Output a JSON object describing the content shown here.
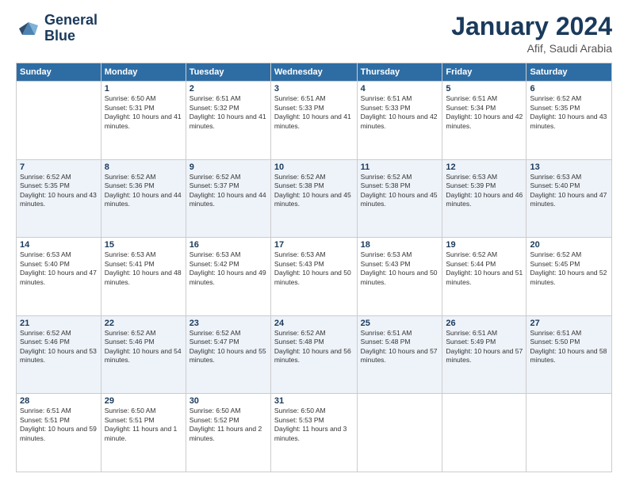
{
  "header": {
    "logo_line1": "General",
    "logo_line2": "Blue",
    "month": "January 2024",
    "location": "Afif, Saudi Arabia"
  },
  "weekdays": [
    "Sunday",
    "Monday",
    "Tuesday",
    "Wednesday",
    "Thursday",
    "Friday",
    "Saturday"
  ],
  "weeks": [
    [
      {
        "day": "",
        "sunrise": "",
        "sunset": "",
        "daylight": ""
      },
      {
        "day": "1",
        "sunrise": "Sunrise: 6:50 AM",
        "sunset": "Sunset: 5:31 PM",
        "daylight": "Daylight: 10 hours and 41 minutes."
      },
      {
        "day": "2",
        "sunrise": "Sunrise: 6:51 AM",
        "sunset": "Sunset: 5:32 PM",
        "daylight": "Daylight: 10 hours and 41 minutes."
      },
      {
        "day": "3",
        "sunrise": "Sunrise: 6:51 AM",
        "sunset": "Sunset: 5:33 PM",
        "daylight": "Daylight: 10 hours and 41 minutes."
      },
      {
        "day": "4",
        "sunrise": "Sunrise: 6:51 AM",
        "sunset": "Sunset: 5:33 PM",
        "daylight": "Daylight: 10 hours and 42 minutes."
      },
      {
        "day": "5",
        "sunrise": "Sunrise: 6:51 AM",
        "sunset": "Sunset: 5:34 PM",
        "daylight": "Daylight: 10 hours and 42 minutes."
      },
      {
        "day": "6",
        "sunrise": "Sunrise: 6:52 AM",
        "sunset": "Sunset: 5:35 PM",
        "daylight": "Daylight: 10 hours and 43 minutes."
      }
    ],
    [
      {
        "day": "7",
        "sunrise": "Sunrise: 6:52 AM",
        "sunset": "Sunset: 5:35 PM",
        "daylight": "Daylight: 10 hours and 43 minutes."
      },
      {
        "day": "8",
        "sunrise": "Sunrise: 6:52 AM",
        "sunset": "Sunset: 5:36 PM",
        "daylight": "Daylight: 10 hours and 44 minutes."
      },
      {
        "day": "9",
        "sunrise": "Sunrise: 6:52 AM",
        "sunset": "Sunset: 5:37 PM",
        "daylight": "Daylight: 10 hours and 44 minutes."
      },
      {
        "day": "10",
        "sunrise": "Sunrise: 6:52 AM",
        "sunset": "Sunset: 5:38 PM",
        "daylight": "Daylight: 10 hours and 45 minutes."
      },
      {
        "day": "11",
        "sunrise": "Sunrise: 6:52 AM",
        "sunset": "Sunset: 5:38 PM",
        "daylight": "Daylight: 10 hours and 45 minutes."
      },
      {
        "day": "12",
        "sunrise": "Sunrise: 6:53 AM",
        "sunset": "Sunset: 5:39 PM",
        "daylight": "Daylight: 10 hours and 46 minutes."
      },
      {
        "day": "13",
        "sunrise": "Sunrise: 6:53 AM",
        "sunset": "Sunset: 5:40 PM",
        "daylight": "Daylight: 10 hours and 47 minutes."
      }
    ],
    [
      {
        "day": "14",
        "sunrise": "Sunrise: 6:53 AM",
        "sunset": "Sunset: 5:40 PM",
        "daylight": "Daylight: 10 hours and 47 minutes."
      },
      {
        "day": "15",
        "sunrise": "Sunrise: 6:53 AM",
        "sunset": "Sunset: 5:41 PM",
        "daylight": "Daylight: 10 hours and 48 minutes."
      },
      {
        "day": "16",
        "sunrise": "Sunrise: 6:53 AM",
        "sunset": "Sunset: 5:42 PM",
        "daylight": "Daylight: 10 hours and 49 minutes."
      },
      {
        "day": "17",
        "sunrise": "Sunrise: 6:53 AM",
        "sunset": "Sunset: 5:43 PM",
        "daylight": "Daylight: 10 hours and 50 minutes."
      },
      {
        "day": "18",
        "sunrise": "Sunrise: 6:53 AM",
        "sunset": "Sunset: 5:43 PM",
        "daylight": "Daylight: 10 hours and 50 minutes."
      },
      {
        "day": "19",
        "sunrise": "Sunrise: 6:52 AM",
        "sunset": "Sunset: 5:44 PM",
        "daylight": "Daylight: 10 hours and 51 minutes."
      },
      {
        "day": "20",
        "sunrise": "Sunrise: 6:52 AM",
        "sunset": "Sunset: 5:45 PM",
        "daylight": "Daylight: 10 hours and 52 minutes."
      }
    ],
    [
      {
        "day": "21",
        "sunrise": "Sunrise: 6:52 AM",
        "sunset": "Sunset: 5:46 PM",
        "daylight": "Daylight: 10 hours and 53 minutes."
      },
      {
        "day": "22",
        "sunrise": "Sunrise: 6:52 AM",
        "sunset": "Sunset: 5:46 PM",
        "daylight": "Daylight: 10 hours and 54 minutes."
      },
      {
        "day": "23",
        "sunrise": "Sunrise: 6:52 AM",
        "sunset": "Sunset: 5:47 PM",
        "daylight": "Daylight: 10 hours and 55 minutes."
      },
      {
        "day": "24",
        "sunrise": "Sunrise: 6:52 AM",
        "sunset": "Sunset: 5:48 PM",
        "daylight": "Daylight: 10 hours and 56 minutes."
      },
      {
        "day": "25",
        "sunrise": "Sunrise: 6:51 AM",
        "sunset": "Sunset: 5:48 PM",
        "daylight": "Daylight: 10 hours and 57 minutes."
      },
      {
        "day": "26",
        "sunrise": "Sunrise: 6:51 AM",
        "sunset": "Sunset: 5:49 PM",
        "daylight": "Daylight: 10 hours and 57 minutes."
      },
      {
        "day": "27",
        "sunrise": "Sunrise: 6:51 AM",
        "sunset": "Sunset: 5:50 PM",
        "daylight": "Daylight: 10 hours and 58 minutes."
      }
    ],
    [
      {
        "day": "28",
        "sunrise": "Sunrise: 6:51 AM",
        "sunset": "Sunset: 5:51 PM",
        "daylight": "Daylight: 10 hours and 59 minutes."
      },
      {
        "day": "29",
        "sunrise": "Sunrise: 6:50 AM",
        "sunset": "Sunset: 5:51 PM",
        "daylight": "Daylight: 11 hours and 1 minute."
      },
      {
        "day": "30",
        "sunrise": "Sunrise: 6:50 AM",
        "sunset": "Sunset: 5:52 PM",
        "daylight": "Daylight: 11 hours and 2 minutes."
      },
      {
        "day": "31",
        "sunrise": "Sunrise: 6:50 AM",
        "sunset": "Sunset: 5:53 PM",
        "daylight": "Daylight: 11 hours and 3 minutes."
      },
      {
        "day": "",
        "sunrise": "",
        "sunset": "",
        "daylight": ""
      },
      {
        "day": "",
        "sunrise": "",
        "sunset": "",
        "daylight": ""
      },
      {
        "day": "",
        "sunrise": "",
        "sunset": "",
        "daylight": ""
      }
    ]
  ]
}
